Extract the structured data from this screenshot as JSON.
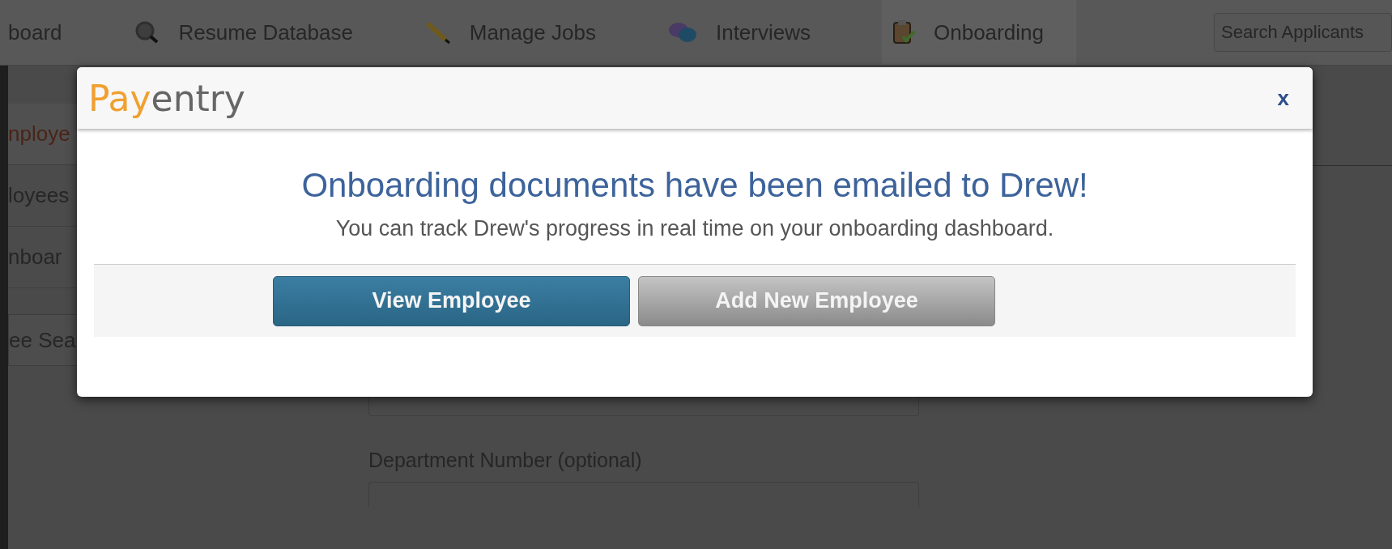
{
  "nav": {
    "items": [
      {
        "label": "board",
        "selected": false
      },
      {
        "label": "Resume Database",
        "selected": false
      },
      {
        "label": "Manage Jobs",
        "selected": false
      },
      {
        "label": "Interviews",
        "selected": false
      },
      {
        "label": "Onboarding",
        "selected": true
      }
    ],
    "search": {
      "placeholder": "Search Applicants"
    }
  },
  "sidebar": {
    "items": [
      {
        "label": "nploye",
        "selected": true
      },
      {
        "label": "loyees",
        "selected": false
      },
      {
        "label": "nboar",
        "selected": false
      }
    ],
    "search": {
      "placeholder": "ee Sea"
    }
  },
  "form": {
    "fields": [
      {
        "label": "Department Number (optional)"
      }
    ]
  },
  "dialog": {
    "logo": {
      "first": "Pay",
      "second": "entry"
    },
    "close": "x",
    "title": "Onboarding documents have been emailed to Drew!",
    "message": "You can track Drew's progress in real time on your onboarding dashboard.",
    "buttons": [
      {
        "label": "View Employee",
        "kind": "primary"
      },
      {
        "label": "Add New Employee",
        "kind": "secondary"
      }
    ]
  }
}
